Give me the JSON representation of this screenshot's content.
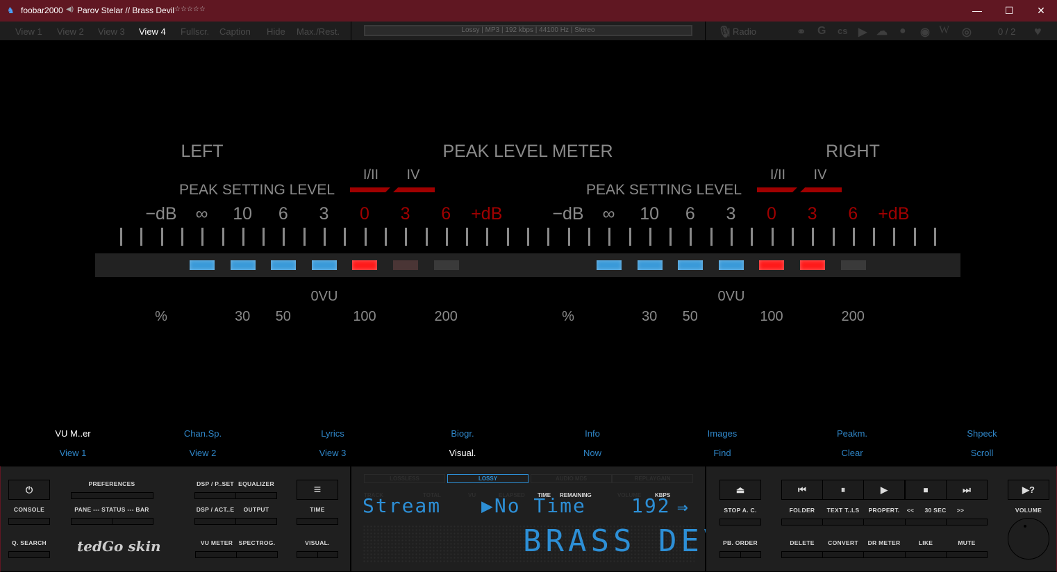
{
  "titlebar": {
    "app": "foobar2000",
    "track": "Parov Stelar // Brass Devil",
    "rating": "☆☆☆☆☆",
    "minimize": "—",
    "maximize": "☐",
    "close": "✕"
  },
  "toolbar": {
    "items": [
      "View 1",
      "View 2",
      "View 3",
      "View 4",
      "Fullscr.",
      "Caption",
      "Hide",
      "Max./Rest."
    ],
    "active": 3,
    "info": "Lossy | MP3 | 192 kbps | 44100 Hz | Stereo",
    "radio": "| Radio",
    "count": "0 / 2"
  },
  "meter": {
    "title": "PEAK  LEVEL METER",
    "left": "LEFT",
    "right": "RIGHT",
    "peak_setting": "PEAK  SETTING  LEVEL",
    "level_marks": [
      "I/II",
      "IV"
    ],
    "db_scale": [
      "−dB",
      "∞",
      "10",
      "6",
      "3",
      "0",
      "3",
      "6",
      "+dB"
    ],
    "vu_label": "0VU",
    "percent_scale": [
      "%",
      "30",
      "50",
      "100",
      "200"
    ],
    "channels": [
      {
        "name": "left",
        "leds": [
          "blue",
          "blue",
          "blue",
          "blue",
          "red",
          "dimred",
          "off"
        ]
      },
      {
        "name": "right",
        "leds": [
          "blue",
          "blue",
          "blue",
          "blue",
          "red",
          "red",
          "off"
        ]
      }
    ],
    "colors": {
      "blue": "#3a9ad9",
      "red": "#ff1a1a",
      "dimred": "#4a3535",
      "off": "#3a3a3a"
    }
  },
  "tabs": {
    "row1": [
      "VU M..er",
      "Chan.Sp.",
      "Lyrics",
      "Biogr.",
      "Info",
      "Images",
      "Peakm.",
      "Shpeck"
    ],
    "row2": [
      "View 1",
      "View 2",
      "View 3",
      "Visual.",
      "Now",
      "Find",
      "Clear",
      "Scroll"
    ]
  },
  "left_panel": {
    "console": "CONSOLE",
    "preferences": "PREFERENCES",
    "pane_status_bar": "PANE --- STATUS --- BAR",
    "dsp_preset": "DSP / P..SET",
    "equalizer": "EQUALIZER",
    "dsp_active": "DSP / ACT..E",
    "output": "OUTPUT",
    "time": "TIME",
    "q_search": "Q. SEARCH",
    "logo": "tedGo skin",
    "vu_meter": "VU METER",
    "spectrog": "SPECTROG.",
    "visual": "VISUAL.",
    "power": "⏻",
    "menu": "≡"
  },
  "lcd": {
    "formats": [
      "LOSSLESS",
      "LOSSY",
      "AUDIO MD5",
      "REPLAYGAIN"
    ],
    "active_format": 1,
    "labels": {
      "track": "TRACK",
      "total": "TOTAL",
      "vu": "VU",
      "elapsed": "ELAPSED",
      "time": "TIME",
      "remaining": "REMAINING",
      "volume": "VOLUME",
      "kbps": "KBPS"
    },
    "source": "Stream",
    "time_value": "▶No Time",
    "kbps_value": "192",
    "arrow": "⇒",
    "title_scroll": "BRASS DEVI"
  },
  "right_panel": {
    "eject": "⏏",
    "stop_ac": "STOP A. C.",
    "pb_order": "PB. ORDER",
    "transport": [
      "⏮",
      "⏸",
      "▶",
      "⏹",
      "⏭"
    ],
    "row1": [
      "FOLDER",
      "TEXT T..LS",
      "PROPERT.",
      "<<",
      "30 SEC",
      ">>"
    ],
    "row2": [
      "DELETE",
      "CONVERT",
      "DR METER",
      "LIKE",
      "MUTE"
    ],
    "random": "▶?",
    "volume": "VOLUME"
  }
}
